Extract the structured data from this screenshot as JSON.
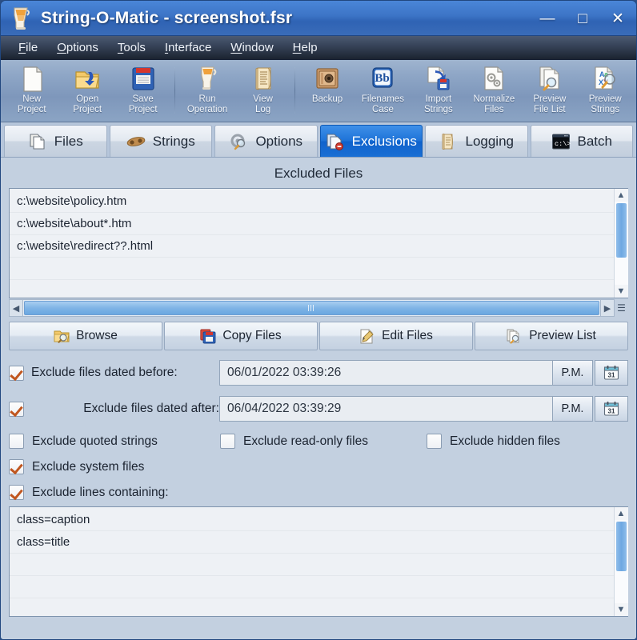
{
  "window": {
    "title": "String-O-Matic - screenshot.fsr",
    "app_icon": "blender-icon",
    "controls": [
      {
        "name": "minimize-button",
        "glyph": "—"
      },
      {
        "name": "maximize-button",
        "glyph": "□"
      },
      {
        "name": "close-button",
        "glyph": "✕"
      }
    ]
  },
  "menubar": {
    "items": [
      {
        "label": "File",
        "mnemonic": "F"
      },
      {
        "label": "Options",
        "mnemonic": "O"
      },
      {
        "label": "Tools",
        "mnemonic": "T"
      },
      {
        "label": "Interface",
        "mnemonic": "I"
      },
      {
        "label": "Window",
        "mnemonic": "W"
      },
      {
        "label": "Help",
        "mnemonic": "H"
      }
    ]
  },
  "toolbar": {
    "buttons": [
      {
        "name": "new-project",
        "line1": "New",
        "line2": "Project",
        "icon": "page-icon"
      },
      {
        "name": "open-project",
        "line1": "Open",
        "line2": "Project",
        "icon": "folder-open-icon"
      },
      {
        "name": "save-project",
        "line1": "Save",
        "line2": "Project",
        "icon": "floppy-disk-icon"
      },
      {
        "name": "run-operation",
        "line1": "Run",
        "line2": "Operation",
        "icon": "blender-icon"
      },
      {
        "name": "view-log",
        "line1": "View",
        "line2": "Log",
        "icon": "scroll-icon"
      },
      {
        "name": "backup",
        "line1": "Backup",
        "line2": "",
        "icon": "safe-icon"
      },
      {
        "name": "filenames-case",
        "line1": "Filenames",
        "line2": "Case",
        "icon": "bb-case-icon"
      },
      {
        "name": "import-strings",
        "line1": "Import",
        "line2": "Strings",
        "icon": "import-icon"
      },
      {
        "name": "normalize-files",
        "line1": "Normalize",
        "line2": "Files",
        "icon": "gears-page-icon"
      },
      {
        "name": "preview-file-list",
        "line1": "Preview",
        "line2": "File List",
        "icon": "pages-magnifier-icon"
      },
      {
        "name": "preview-strings",
        "line1": "Preview",
        "line2": "Strings",
        "icon": "axy-magnifier-icon"
      }
    ],
    "separators_after": [
      2,
      4
    ]
  },
  "tabs": [
    {
      "name": "tab-files",
      "label": "Files",
      "icon": "pages-icon",
      "active": false
    },
    {
      "name": "tab-strings",
      "label": "Strings",
      "icon": "peanut-icon",
      "active": false
    },
    {
      "name": "tab-options",
      "label": "Options",
      "icon": "gear-magnifier-icon",
      "active": false
    },
    {
      "name": "tab-exclusions",
      "label": "Exclusions",
      "icon": "pages-deny-icon",
      "active": true
    },
    {
      "name": "tab-logging",
      "label": "Logging",
      "icon": "scroll-icon",
      "active": false
    },
    {
      "name": "tab-batch",
      "label": "Batch",
      "icon": "console-icon",
      "active": false
    }
  ],
  "content": {
    "section_title": "Excluded Files",
    "excluded_files": [
      "c:\\website\\policy.htm",
      "c:\\website\\about*.htm",
      "c:\\website\\redirect??.html"
    ],
    "action_buttons": [
      {
        "name": "browse-button",
        "label": "Browse",
        "icon": "folder-magnifier-icon"
      },
      {
        "name": "copy-files-button",
        "label": "Copy Files",
        "icon": "floppy-copy-icon"
      },
      {
        "name": "edit-files-button",
        "label": "Edit Files",
        "icon": "pencil-page-icon"
      },
      {
        "name": "preview-list-button",
        "label": "Preview List",
        "icon": "pages-magnifier-icon"
      }
    ],
    "date_rows": [
      {
        "name": "exclude-dated-before",
        "label": "Exclude files dated before:",
        "checked": true,
        "value": "06/01/2022 03:39:26",
        "ampm": "P.M.",
        "calendar_icon": "calendar-icon"
      },
      {
        "name": "exclude-dated-after",
        "label": "Exclude files dated after:",
        "checked": true,
        "value": "06/04/2022 03:39:29",
        "ampm": "P.M.",
        "calendar_icon": "calendar-icon"
      }
    ],
    "checkbox_grid": [
      {
        "name": "exclude-quoted-strings",
        "label": "Exclude quoted strings",
        "checked": false
      },
      {
        "name": "exclude-read-only-files",
        "label": "Exclude read-only files",
        "checked": false
      },
      {
        "name": "exclude-hidden-files",
        "label": "Exclude hidden files",
        "checked": false
      }
    ],
    "exclude_system_files": {
      "name": "exclude-system-files",
      "label": "Exclude system files",
      "checked": true
    },
    "exclude_lines_containing": {
      "name": "exclude-lines-containing",
      "label": "Exclude lines containing:",
      "checked": true
    },
    "excluded_lines": [
      "class=caption",
      "class=title"
    ]
  },
  "colors": {
    "title_bar": "#3d75c7",
    "accent_tab": "#1e73d8",
    "panel": "#c3d0e0",
    "check_mark": "#c0561f",
    "scroll_thumb": "#7fb4e6"
  }
}
